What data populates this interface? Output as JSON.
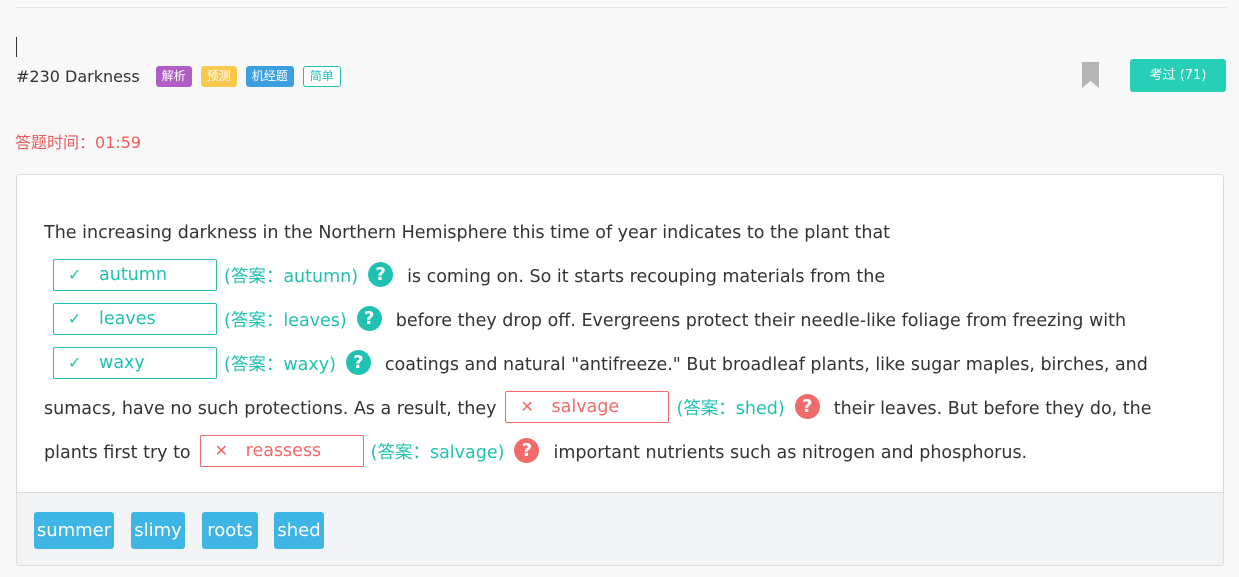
{
  "question": {
    "title": "#230 Darkness",
    "tags": [
      "解析",
      "预测",
      "机经题",
      "简单"
    ],
    "exam_button": "考过 (71)"
  },
  "timer": "答题时间：01:59",
  "passage": {
    "seg0": "The increasing darkness in the Northern Hemisphere this time of year indicates to the plant that",
    "blank1": {
      "value": "autumn",
      "answer": "(答案：autumn)",
      "correct": true
    },
    "seg1": "is coming on. So it starts recouping materials from the",
    "blank2": {
      "value": "leaves",
      "answer": "(答案：leaves)",
      "correct": true
    },
    "seg2": "before they drop off. Evergreens protect their needle-like foliage from freezing with",
    "blank3": {
      "value": "waxy",
      "answer": "(答案：waxy)",
      "correct": true
    },
    "seg3": "coatings and natural \"antifreeze.\" But broadleaf plants, like sugar maples, birches, and sumacs, have no such protections. As a result, they",
    "blank4": {
      "value": "salvage",
      "answer": "(答案：shed)",
      "correct": false
    },
    "seg4": "their leaves. But before they do, the plants first try to",
    "blank5": {
      "value": "reassess",
      "answer": "(答案：salvage)",
      "correct": false
    },
    "seg5": "important nutrients such as nitrogen and phosphorus."
  },
  "word_bank": [
    "summer",
    "slimy",
    "roots",
    "shed"
  ],
  "icons": {
    "correct": "check-icon",
    "wrong": "cross-icon",
    "help": "question-circle-icon",
    "bookmark": "bookmark-icon"
  },
  "colors": {
    "teal": "#21c1b1",
    "red": "#f26a6a",
    "blue": "#3fb5e5",
    "purple": "#b05dc5",
    "yellow": "#f9c84f",
    "tag_blue": "#3c9fe0"
  }
}
